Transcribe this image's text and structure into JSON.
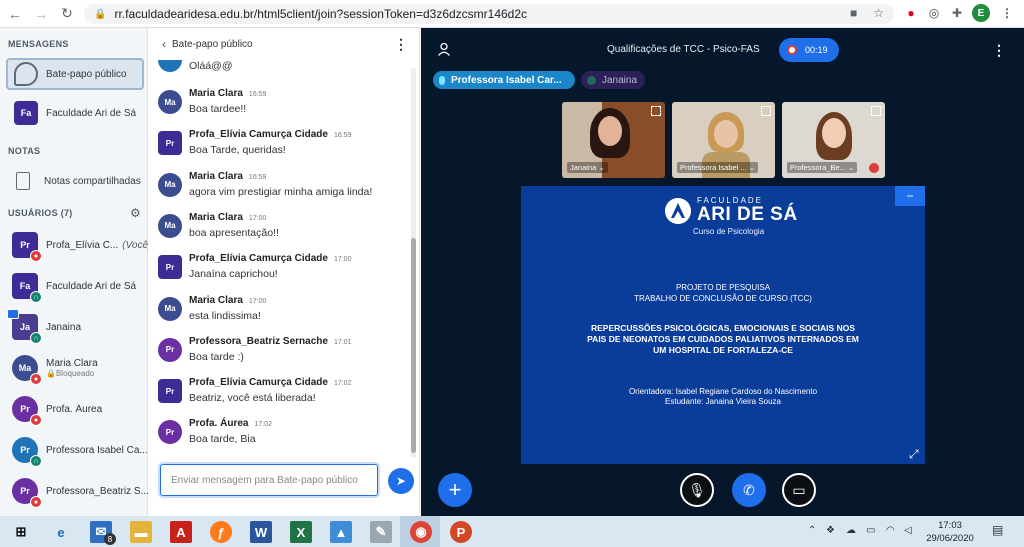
{
  "browser": {
    "url": "rr.faculdadearidesa.edu.br/html5client/join?sessionToken=d3z6dzcsmr146d2c",
    "profile_initial": "E"
  },
  "left_nav": {
    "messages_title": "MENSAGENS",
    "public_chat": "Bate-papo público",
    "faculdade_chat": {
      "initials": "Fa",
      "name": "Faculdade Ari de Sá"
    },
    "notes_title": "NOTAS",
    "shared_notes": "Notas compartilhadas",
    "users_title": "USUÁRIOS (7)",
    "users": [
      {
        "initials": "Pr",
        "name": "Profa_Elívia C...",
        "suffix": "(Você)",
        "sub": "",
        "color": "#3f2b96",
        "shape": "sq",
        "badge": "mic-off"
      },
      {
        "initials": "Fa",
        "name": "Faculdade Ari de Sá",
        "suffix": "",
        "sub": "",
        "color": "#3f2b96",
        "shape": "sq",
        "badge": "listen"
      },
      {
        "initials": "Ja",
        "name": "Janaina",
        "suffix": "",
        "sub": "",
        "color": "#4a3d8f",
        "shape": "sq",
        "badge": "listen"
      },
      {
        "initials": "Ma",
        "name": "Maria Clara",
        "suffix": "",
        "sub": "🔒Bloqueado",
        "color": "#3b4d8f",
        "shape": "ci",
        "badge": "mic-off"
      },
      {
        "initials": "Pr",
        "name": "Profa. Áurea",
        "suffix": "",
        "sub": "",
        "color": "#6a2fa0",
        "shape": "ci",
        "badge": "mic-off"
      },
      {
        "initials": "Pr",
        "name": "Professora Isabel Ca...",
        "suffix": "",
        "sub": "",
        "color": "#1f73b7",
        "shape": "ci",
        "badge": "listen"
      },
      {
        "initials": "Pr",
        "name": "Professora_Beatriz S...",
        "suffix": "",
        "sub": "",
        "color": "#6a2fa0",
        "shape": "ci",
        "badge": "mic-off"
      }
    ]
  },
  "chat": {
    "title": "Bate-papo público",
    "first_partial": "Oláá@@",
    "messages": [
      {
        "initials": "Ma",
        "name": "Maria Clara",
        "time": "16:59",
        "text": "Boa tardee!!",
        "color": "#3b4d8f",
        "shape": "ci"
      },
      {
        "initials": "Pr",
        "name": "Profa_Elívia Camurça Cidade",
        "time": "16:59",
        "text": "Boa Tarde, queridas!",
        "color": "#3f2b96",
        "shape": "sq"
      },
      {
        "initials": "Ma",
        "name": "Maria Clara",
        "time": "16:59",
        "text": "agora vim prestigiar minha amiga linda!",
        "color": "#3b4d8f",
        "shape": "ci"
      },
      {
        "initials": "Ma",
        "name": "Maria Clara",
        "time": "17:00",
        "text": "boa apresentação!!",
        "color": "#3b4d8f",
        "shape": "ci"
      },
      {
        "initials": "Pr",
        "name": "Profa_Elívia Camurça Cidade",
        "time": "17:00",
        "text": "Janaína caprichou!",
        "color": "#3f2b96",
        "shape": "sq"
      },
      {
        "initials": "Ma",
        "name": "Maria Clara",
        "time": "17:00",
        "text": "esta lindissima!",
        "color": "#3b4d8f",
        "shape": "ci"
      },
      {
        "initials": "Pr",
        "name": "Professora_Beatriz Sernache",
        "time": "17:01",
        "text": "Boa tarde :)",
        "color": "#6a2fa0",
        "shape": "ci"
      },
      {
        "initials": "Pr",
        "name": "Profa_Elívia Camurça Cidade",
        "time": "17:02",
        "text": "Beatriz, você está liberada!",
        "color": "#3f2b96",
        "shape": "sq"
      },
      {
        "initials": "Pr",
        "name": "Profa. Áurea",
        "time": "17:02",
        "text": "Boa tarde, Bia",
        "color": "#6a2fa0",
        "shape": "ci"
      }
    ],
    "input_placeholder": "Enviar mensagem para Bate-papo público"
  },
  "main": {
    "title": "Qualificações de TCC - Psico-FAS",
    "recording_time": "00:19",
    "talkers": [
      "Professora Isabel Car...",
      "Janaina"
    ],
    "videos": [
      {
        "name": "Janaina ⌄"
      },
      {
        "name": "Professora Isabel ... ⌄"
      },
      {
        "name": "Professora_Be... ⌄"
      }
    ]
  },
  "slide": {
    "logo_top": "FACULDADE",
    "logo_main": "ARI DE SÁ",
    "logo_sub": "Curso de Psicologia",
    "line1": "PROJETO DE PESQUISA",
    "line2": "TRABALHO DE CONCLUSÃO DE CURSO (TCC)",
    "title1": "REPERCUSSÕES PSICOLÓGICAS, EMOCIONAIS E SOCIAIS NOS",
    "title2": "PAIS DE NEONATOS EM CUIDADOS PALIATIVOS INTERNADOS EM",
    "title3": "UM HOSPITAL DE FORTALEZA-CE",
    "advisor": "Orientadora: Isabel Regiane Cardoso do Nascimento",
    "student": "Estudante: Janaina Vieira Souza"
  },
  "taskbar": {
    "mail_count": "8",
    "time": "17:03",
    "date": "29/06/2020"
  }
}
